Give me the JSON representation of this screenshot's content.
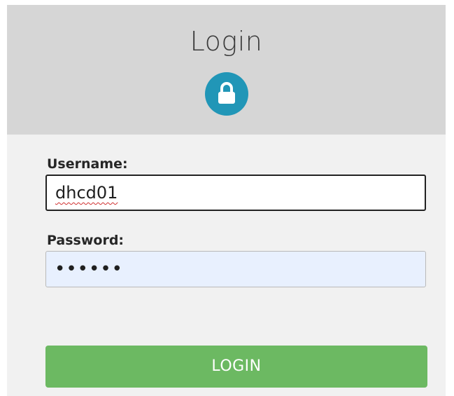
{
  "header": {
    "title": "Login",
    "icon": "lock-icon",
    "accent_color": "#2196b7"
  },
  "form": {
    "username_label": "Username:",
    "username_value": "dhcd01",
    "password_label": "Password:",
    "password_masked": "••••••"
  },
  "actions": {
    "login_label": "LOGIN",
    "login_color": "#6cb962"
  }
}
